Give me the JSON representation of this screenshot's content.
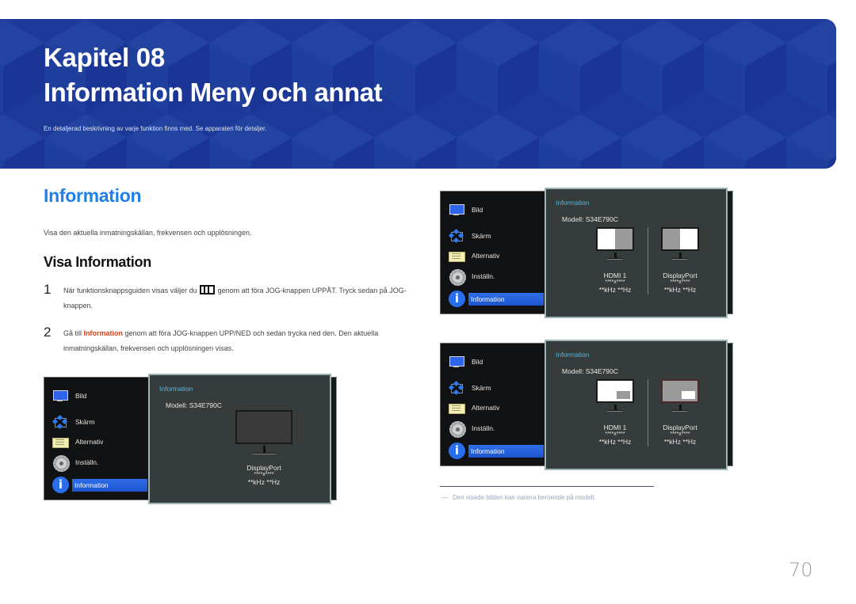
{
  "banner": {
    "chapter": "Kapitel 08",
    "title": "Information Meny och annat",
    "description": "En detaljerad beskrivning av varje funktion finns med. Se apparaten för detaljer.",
    "color": "#1d3a98"
  },
  "section": {
    "title": "Information",
    "intro": "Visa den aktuella inmatningskällan, frekvensen och upplösningen.",
    "subtitle": "Visa Information",
    "steps": [
      {
        "number": "1",
        "text_before": "När funktionsknappsguiden visas väljer du",
        "icon": "menu-icon",
        "text_after": "genom att föra JOG-knappen UPPÅT. Tryck sedan på JOG-knappen."
      },
      {
        "number": "2",
        "text_before": "Gå till",
        "highlight": "Information",
        "text_after": "genom att föra JOG-knappen UPP/NED och sedan trycka ned den. Den aktuella inmatningskällan, frekvensen och upplösningen visas."
      }
    ]
  },
  "osd_menu": {
    "items": [
      {
        "label": "Bild",
        "icon": "picture-icon"
      },
      {
        "label": "Skärm",
        "icon": "screen-adjust-icon"
      },
      {
        "label": "Alternativ",
        "icon": "options-icon"
      },
      {
        "label": "Inställn.",
        "icon": "settings-gear-icon"
      },
      {
        "label": "Information",
        "icon": "info-icon",
        "active": true
      }
    ]
  },
  "screenshots": [
    {
      "panel_title": "Information",
      "model": "Modell: S34E790C",
      "sources": [
        {
          "name": "DisplayPort",
          "resolution": "****x****",
          "frequency": "**kHz **Hz",
          "layout": "single"
        }
      ]
    },
    {
      "panel_title": "Information",
      "model": "Modell: S34E790C",
      "sources": [
        {
          "name": "HDMI 1",
          "resolution": "****x****",
          "frequency": "**kHz **Hz",
          "layout": "pbp-left"
        },
        {
          "name": "DisplayPort",
          "resolution": "****x****",
          "frequency": "**kHz **Hz",
          "layout": "pbp-right"
        }
      ]
    },
    {
      "panel_title": "Information",
      "model": "Modell: S34E790C",
      "sources": [
        {
          "name": "HDMI 1",
          "resolution": "****x****",
          "frequency": "**kHz **Hz",
          "layout": "pip-main"
        },
        {
          "name": "DisplayPort",
          "resolution": "****x****",
          "frequency": "**kHz **Hz",
          "layout": "pip-sub"
        }
      ]
    }
  ],
  "footnote": {
    "dash": "―",
    "text": "Den visade bilden kan variera beroende på modell."
  },
  "page_number": "70"
}
